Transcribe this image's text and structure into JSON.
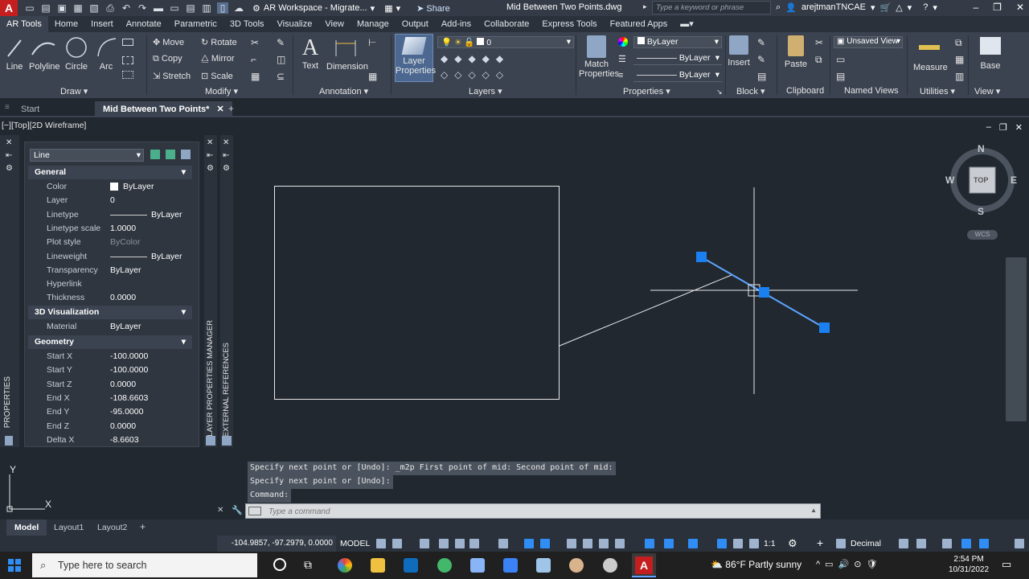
{
  "titlebar": {
    "app_logo": "A",
    "workspace": "AR Workspace - Migrate...",
    "share": "Share",
    "document_title": "Mid Between Two Points.dwg",
    "search_placeholder": "Type a keyword or phrase",
    "user": "arejtmanTNCAE"
  },
  "menu_tabs": [
    "AR Tools",
    "Home",
    "Insert",
    "Annotate",
    "Parametric",
    "3D Tools",
    "Visualize",
    "View",
    "Manage",
    "Output",
    "Add-ins",
    "Collaborate",
    "Express Tools",
    "Featured Apps"
  ],
  "ribbon": {
    "draw": {
      "line": "Line",
      "polyline": "Polyline",
      "circle": "Circle",
      "arc": "Arc",
      "label": "Draw"
    },
    "modify": {
      "move": "Move",
      "rotate": "Rotate",
      "copy": "Copy",
      "mirror": "Mirror",
      "stretch": "Stretch",
      "scale": "Scale",
      "label": "Modify"
    },
    "annotation": {
      "text": "Text",
      "dimension": "Dimension",
      "label": "Annotation"
    },
    "layers": {
      "layer_properties": "Layer Properties",
      "layer_properties_l1": "Layer",
      "layer_properties_l2": "Properties",
      "current_layer": "0",
      "label": "Layers"
    },
    "properties": {
      "match_l1": "Match",
      "match_l2": "Properties",
      "color": "ByLayer",
      "linetype": "ByLayer",
      "lineweight": "ByLayer",
      "label": "Properties"
    },
    "block": {
      "insert": "Insert",
      "label": "Block"
    },
    "clipboard": {
      "paste": "Paste",
      "label": "Clipboard"
    },
    "named_views": {
      "view": "Unsaved View",
      "label": "Named Views"
    },
    "utilities": {
      "measure": "Measure",
      "label": "Utilities"
    },
    "view": {
      "base": "Base",
      "label": "View"
    }
  },
  "doc_tabs": {
    "start": "Start",
    "active": "Mid Between Two Points*"
  },
  "viewport_label": "[−][Top][2D Wireframe]",
  "properties_palette": {
    "strip_label": "PROPERTIES",
    "object_type": "Line",
    "sections": {
      "general": "General",
      "visualization": "3D Visualization",
      "geometry": "Geometry"
    },
    "general": [
      {
        "k": "Color",
        "v": "ByLayer"
      },
      {
        "k": "Layer",
        "v": "0"
      },
      {
        "k": "Linetype",
        "v": "ByLayer"
      },
      {
        "k": "Linetype scale",
        "v": "1.0000"
      },
      {
        "k": "Plot style",
        "v": "ByColor"
      },
      {
        "k": "Lineweight",
        "v": "ByLayer"
      },
      {
        "k": "Transparency",
        "v": "ByLayer"
      },
      {
        "k": "Hyperlink",
        "v": ""
      },
      {
        "k": "Thickness",
        "v": "0.0000"
      }
    ],
    "visualization": [
      {
        "k": "Material",
        "v": "ByLayer"
      }
    ],
    "geometry": [
      {
        "k": "Start X",
        "v": "-100.0000"
      },
      {
        "k": "Start Y",
        "v": "-100.0000"
      },
      {
        "k": "Start Z",
        "v": "0.0000"
      },
      {
        "k": "End X",
        "v": "-108.6603"
      },
      {
        "k": "End Y",
        "v": "-95.0000"
      },
      {
        "k": "End Z",
        "v": "0.0000"
      },
      {
        "k": "Delta X",
        "v": "-8.6603"
      }
    ]
  },
  "side_tabs": {
    "layer_properties_manager": "LAYER PROPERTIES MANAGER",
    "external_references": "EXTERNAL REFERENCES"
  },
  "navcube": {
    "n": "N",
    "s": "S",
    "e": "E",
    "w": "W",
    "top": "TOP",
    "wcs": "WCS"
  },
  "ucs": {
    "x": "X",
    "y": "Y"
  },
  "command_history": [
    "Specify next point or [Undo]: _m2p First point of mid: Second point of mid:",
    "Specify next point or [Undo]:",
    "Command:"
  ],
  "command_placeholder": "Type a command",
  "layout_tabs": [
    "Model",
    "Layout1",
    "Layout2"
  ],
  "status": {
    "coords": "-104.9857, -97.2979, 0.0000",
    "model": "MODEL",
    "scale": "1:1",
    "units": "Decimal"
  },
  "taskbar": {
    "search_placeholder": "Type here to search",
    "weather": "86°F  Partly sunny",
    "time": "2:54 PM",
    "date": "10/31/2022"
  },
  "colors": {
    "accent": "#2f8df5",
    "grip": "#1a7ff0",
    "autocad_red": "#c41e1e"
  }
}
